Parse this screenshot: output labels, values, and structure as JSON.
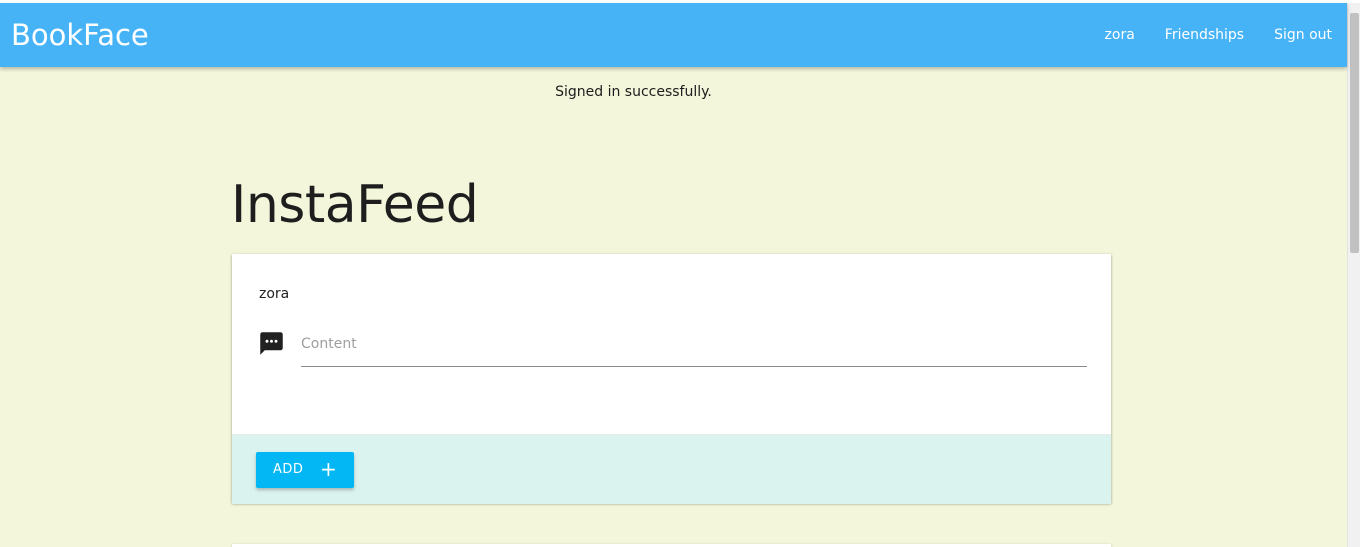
{
  "navbar": {
    "brand": "BookFace",
    "links": [
      {
        "label": "zora"
      },
      {
        "label": "Friendships"
      },
      {
        "label": "Sign out"
      }
    ],
    "color": "#46b3f7"
  },
  "flash": {
    "message": "Signed in successfully."
  },
  "page": {
    "title": "InstaFeed",
    "background": "#f3f6db"
  },
  "post_form": {
    "user": "zora",
    "content_placeholder": "Content",
    "content_value": "",
    "icon": "chat-bubble-icon",
    "add_label": "ADD",
    "add_icon": "plus-icon",
    "add_glyph": "+",
    "button_color": "#03b6f4",
    "action_bg": "#daf3ef"
  }
}
